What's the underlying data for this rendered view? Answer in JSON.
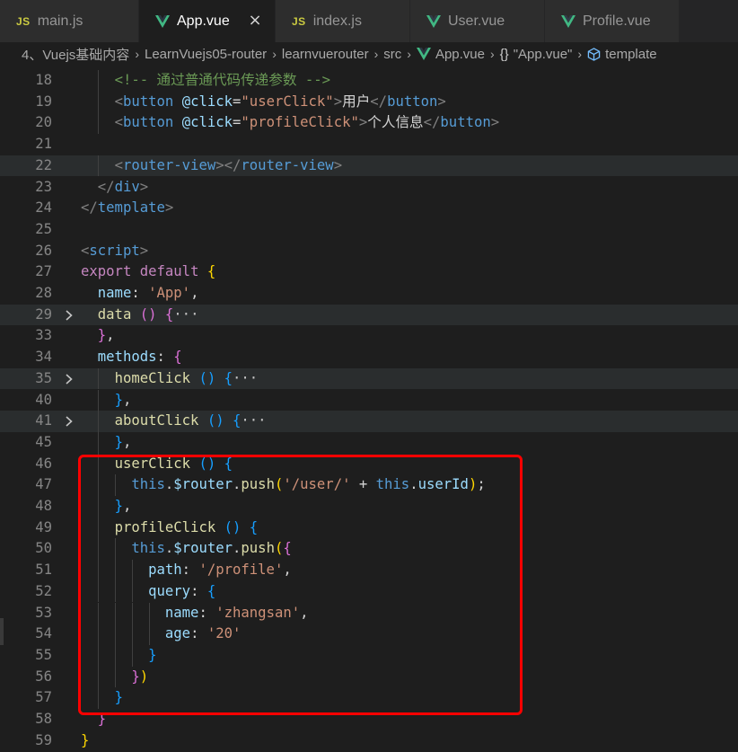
{
  "tabs": [
    {
      "name": "main.js",
      "type": "js",
      "icon": "js-file-icon",
      "active": false
    },
    {
      "name": "App.vue",
      "type": "vue",
      "icon": "vue-file-icon",
      "active": true,
      "close": "×"
    },
    {
      "name": "index.js",
      "type": "js",
      "icon": "js-file-icon",
      "active": false
    },
    {
      "name": "User.vue",
      "type": "vue",
      "icon": "vue-file-icon",
      "active": false
    },
    {
      "name": "Profile.vue",
      "type": "vue",
      "icon": "vue-file-icon",
      "active": false
    }
  ],
  "breadcrumb": [
    {
      "label": "4、Vuejs基础内容"
    },
    {
      "label": "LearnVuejs05-router"
    },
    {
      "label": "learnvuerouter"
    },
    {
      "label": "src"
    },
    {
      "label": "App.vue",
      "icon": "vue-file-icon"
    },
    {
      "label": "\"App.vue\"",
      "icon": "braces-icon",
      "icon_text": "{}"
    },
    {
      "label": "template",
      "icon": "cube-icon"
    }
  ],
  "colors": {
    "vue_green": "#41b883",
    "js_yellow": "#cbcb41",
    "annotation": "#ff0000"
  },
  "editor": {
    "lines": [
      {
        "n": "18",
        "fold": "",
        "hl": false,
        "indent": 2,
        "tokens": [
          [
            "t-cmt",
            "<!-- 通过普通代码传递参数 -->"
          ]
        ]
      },
      {
        "n": "19",
        "fold": "",
        "hl": false,
        "indent": 2,
        "tokens": [
          [
            "t-punct",
            "<"
          ],
          [
            "t-tag",
            "button"
          ],
          [
            "t-txt",
            " "
          ],
          [
            "t-attr",
            "@click"
          ],
          [
            "t-txt",
            "="
          ],
          [
            "t-str",
            "\"userClick\""
          ],
          [
            "t-punct",
            ">"
          ],
          [
            "t-txt",
            "用户"
          ],
          [
            "t-punct",
            "</"
          ],
          [
            "t-tag",
            "button"
          ],
          [
            "t-punct",
            ">"
          ]
        ]
      },
      {
        "n": "20",
        "fold": "",
        "hl": false,
        "indent": 2,
        "tokens": [
          [
            "t-punct",
            "<"
          ],
          [
            "t-tag",
            "button"
          ],
          [
            "t-txt",
            " "
          ],
          [
            "t-attr",
            "@click"
          ],
          [
            "t-txt",
            "="
          ],
          [
            "t-str",
            "\"profileClick\""
          ],
          [
            "t-punct",
            ">"
          ],
          [
            "t-txt",
            "个人信息"
          ],
          [
            "t-punct",
            "</"
          ],
          [
            "t-tag",
            "button"
          ],
          [
            "t-punct",
            ">"
          ]
        ]
      },
      {
        "n": "21",
        "fold": "",
        "hl": false,
        "indent": 0,
        "tokens": []
      },
      {
        "n": "22",
        "fold": "",
        "hl": true,
        "indent": 2,
        "tokens": [
          [
            "t-punct",
            "<"
          ],
          [
            "t-tag",
            "router-view"
          ],
          [
            "t-punct",
            "></"
          ],
          [
            "t-tag",
            "router-view"
          ],
          [
            "t-punct",
            ">"
          ]
        ]
      },
      {
        "n": "23",
        "fold": "",
        "hl": false,
        "indent": 1,
        "tokens": [
          [
            "t-punct",
            "</"
          ],
          [
            "t-tag",
            "div"
          ],
          [
            "t-punct",
            ">"
          ]
        ]
      },
      {
        "n": "24",
        "fold": "",
        "hl": false,
        "indent": 0,
        "tokens": [
          [
            "t-punct",
            "</"
          ],
          [
            "t-tag",
            "template"
          ],
          [
            "t-punct",
            ">"
          ]
        ]
      },
      {
        "n": "25",
        "fold": "",
        "hl": false,
        "indent": 0,
        "tokens": []
      },
      {
        "n": "26",
        "fold": "",
        "hl": false,
        "indent": 0,
        "tokens": [
          [
            "t-punct",
            "<"
          ],
          [
            "t-tag",
            "script"
          ],
          [
            "t-punct",
            ">"
          ]
        ]
      },
      {
        "n": "27",
        "fold": "",
        "hl": false,
        "indent": 0,
        "tokens": [
          [
            "t-ctl",
            "export"
          ],
          [
            "t-txt",
            " "
          ],
          [
            "t-ctl",
            "default"
          ],
          [
            "t-txt",
            " "
          ],
          [
            "t-brace1",
            "{"
          ]
        ]
      },
      {
        "n": "28",
        "fold": "",
        "hl": false,
        "indent": 1,
        "tokens": [
          [
            "t-var",
            "name"
          ],
          [
            "t-txt",
            ": "
          ],
          [
            "t-str",
            "'App'"
          ],
          [
            "t-txt",
            ","
          ]
        ]
      },
      {
        "n": "29",
        "fold": "›",
        "hl": true,
        "indent": 1,
        "tokens": [
          [
            "t-fn",
            "data"
          ],
          [
            "t-txt",
            " "
          ],
          [
            "t-brace2",
            "()"
          ],
          [
            "t-txt",
            " "
          ],
          [
            "t-brace2",
            "{"
          ],
          [
            "t-fold",
            "···"
          ]
        ]
      },
      {
        "n": "33",
        "fold": "",
        "hl": false,
        "indent": 1,
        "tokens": [
          [
            "t-brace2",
            "}"
          ],
          [
            "t-txt",
            ","
          ]
        ]
      },
      {
        "n": "34",
        "fold": "",
        "hl": false,
        "indent": 1,
        "tokens": [
          [
            "t-var",
            "methods"
          ],
          [
            "t-txt",
            ": "
          ],
          [
            "t-brace2",
            "{"
          ]
        ]
      },
      {
        "n": "35",
        "fold": "›",
        "hl": true,
        "indent": 2,
        "tokens": [
          [
            "t-fn",
            "homeClick"
          ],
          [
            "t-txt",
            " "
          ],
          [
            "t-brace3",
            "()"
          ],
          [
            "t-txt",
            " "
          ],
          [
            "t-brace3",
            "{"
          ],
          [
            "t-fold",
            "···"
          ]
        ]
      },
      {
        "n": "40",
        "fold": "",
        "hl": false,
        "indent": 2,
        "tokens": [
          [
            "t-brace3",
            "}"
          ],
          [
            "t-txt",
            ","
          ]
        ]
      },
      {
        "n": "41",
        "fold": "›",
        "hl": true,
        "indent": 2,
        "tokens": [
          [
            "t-fn",
            "aboutClick"
          ],
          [
            "t-txt",
            " "
          ],
          [
            "t-brace3",
            "()"
          ],
          [
            "t-txt",
            " "
          ],
          [
            "t-brace3",
            "{"
          ],
          [
            "t-fold",
            "···"
          ]
        ]
      },
      {
        "n": "45",
        "fold": "",
        "hl": false,
        "indent": 2,
        "tokens": [
          [
            "t-brace3",
            "}"
          ],
          [
            "t-txt",
            ","
          ]
        ]
      },
      {
        "n": "46",
        "fold": "",
        "hl": false,
        "indent": 2,
        "tokens": [
          [
            "t-fn",
            "userClick"
          ],
          [
            "t-txt",
            " "
          ],
          [
            "t-brace3",
            "()"
          ],
          [
            "t-txt",
            " "
          ],
          [
            "t-brace3",
            "{"
          ]
        ]
      },
      {
        "n": "47",
        "fold": "",
        "hl": false,
        "indent": 3,
        "tokens": [
          [
            "t-kw",
            "this"
          ],
          [
            "t-txt",
            "."
          ],
          [
            "t-var",
            "$router"
          ],
          [
            "t-txt",
            "."
          ],
          [
            "t-fn",
            "push"
          ],
          [
            "t-brace1",
            "("
          ],
          [
            "t-str",
            "'/user/'"
          ],
          [
            "t-txt",
            " + "
          ],
          [
            "t-kw",
            "this"
          ],
          [
            "t-txt",
            "."
          ],
          [
            "t-var",
            "userId"
          ],
          [
            "t-brace1",
            ")"
          ],
          [
            "t-txt",
            ";"
          ]
        ]
      },
      {
        "n": "48",
        "fold": "",
        "hl": false,
        "indent": 2,
        "tokens": [
          [
            "t-brace3",
            "}"
          ],
          [
            "t-txt",
            ","
          ]
        ]
      },
      {
        "n": "49",
        "fold": "",
        "hl": false,
        "indent": 2,
        "tokens": [
          [
            "t-fn",
            "profileClick"
          ],
          [
            "t-txt",
            " "
          ],
          [
            "t-brace3",
            "()"
          ],
          [
            "t-txt",
            " "
          ],
          [
            "t-brace3",
            "{"
          ]
        ]
      },
      {
        "n": "50",
        "fold": "",
        "hl": false,
        "indent": 3,
        "tokens": [
          [
            "t-kw",
            "this"
          ],
          [
            "t-txt",
            "."
          ],
          [
            "t-var",
            "$router"
          ],
          [
            "t-txt",
            "."
          ],
          [
            "t-fn",
            "push"
          ],
          [
            "t-brace1",
            "("
          ],
          [
            "t-brace2",
            "{"
          ]
        ]
      },
      {
        "n": "51",
        "fold": "",
        "hl": false,
        "indent": 4,
        "tokens": [
          [
            "t-var",
            "path"
          ],
          [
            "t-txt",
            ": "
          ],
          [
            "t-str",
            "'/profile'"
          ],
          [
            "t-txt",
            ","
          ]
        ]
      },
      {
        "n": "52",
        "fold": "",
        "hl": false,
        "indent": 4,
        "tokens": [
          [
            "t-var",
            "query"
          ],
          [
            "t-txt",
            ": "
          ],
          [
            "t-brace3",
            "{"
          ]
        ]
      },
      {
        "n": "53",
        "fold": "",
        "hl": false,
        "indent": 5,
        "tokens": [
          [
            "t-var",
            "name"
          ],
          [
            "t-txt",
            ": "
          ],
          [
            "t-str",
            "'zhangsan'"
          ],
          [
            "t-txt",
            ","
          ]
        ]
      },
      {
        "n": "54",
        "fold": "",
        "hl": false,
        "indent": 5,
        "tokens": [
          [
            "t-var",
            "age"
          ],
          [
            "t-txt",
            ": "
          ],
          [
            "t-str",
            "'20'"
          ]
        ]
      },
      {
        "n": "55",
        "fold": "",
        "hl": false,
        "indent": 4,
        "tokens": [
          [
            "t-brace3",
            "}"
          ]
        ]
      },
      {
        "n": "56",
        "fold": "",
        "hl": false,
        "indent": 3,
        "tokens": [
          [
            "t-brace2",
            "}"
          ],
          [
            "t-brace1",
            ")"
          ]
        ]
      },
      {
        "n": "57",
        "fold": "",
        "hl": false,
        "indent": 2,
        "tokens": [
          [
            "t-brace3",
            "}"
          ]
        ]
      },
      {
        "n": "58",
        "fold": "",
        "hl": false,
        "indent": 1,
        "tokens": [
          [
            "t-brace2",
            "}"
          ]
        ]
      },
      {
        "n": "59",
        "fold": "",
        "hl": false,
        "indent": 0,
        "tokens": [
          [
            "t-brace1",
            "}"
          ]
        ]
      }
    ]
  }
}
